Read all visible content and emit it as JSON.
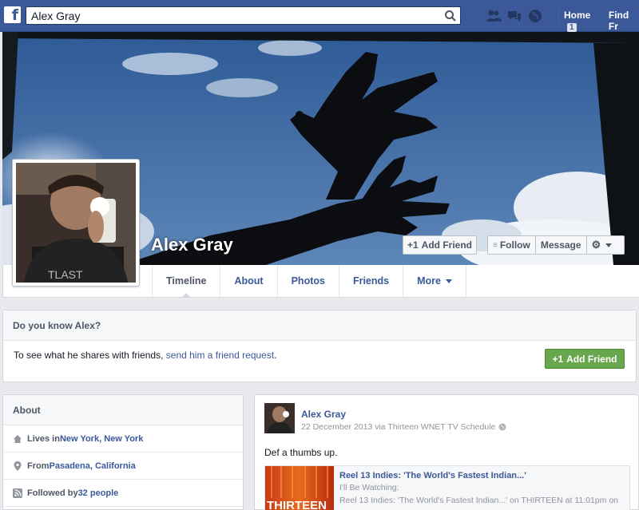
{
  "topbar": {
    "logo": "f",
    "search_value": "Alex Gray",
    "search_icon": "search-icon",
    "jewels": [
      "friend-requests-icon",
      "messages-icon",
      "notifications-globe-icon"
    ],
    "home_label": "Home",
    "home_count": "1",
    "find_friends_label": "Find Fr"
  },
  "profile": {
    "name": "Alex Gray",
    "add_friend_label": "Add Friend",
    "follow_label": "Follow",
    "message_label": "Message"
  },
  "tabs": [
    {
      "label": "Timeline"
    },
    {
      "label": "About"
    },
    {
      "label": "Photos"
    },
    {
      "label": "Friends"
    },
    {
      "label": "More"
    }
  ],
  "know_box": {
    "title": "Do you know Alex?",
    "text_before": "To see what he shares with friends, ",
    "link": "send him a friend request",
    "text_after": ".",
    "button_label": "Add Friend"
  },
  "about": {
    "title": "About",
    "rows": [
      {
        "prefix": "Lives in ",
        "link": "New York, New York",
        "suffix": "",
        "icon": "home-icon"
      },
      {
        "prefix": "From ",
        "link": "Pasadena, California",
        "suffix": "",
        "icon": "location-pin-icon"
      },
      {
        "prefix": "Followed by ",
        "link": "32 people",
        "suffix": "",
        "icon": "followers-icon"
      }
    ]
  },
  "post": {
    "author": "Alex Gray",
    "meta": "22 December 2013 via Thirteen WNET TV Schedule",
    "text": "Def a thumbs up.",
    "share": {
      "title": "Reel 13 Indies: 'The World's Fastest Indian...'",
      "subtitle": "I'll Be Watching:",
      "description": "Reel 13 Indies: 'The World's Fastest Indian...' on THIRTEEN at 11:01pm on",
      "thumb_text": "THIRTEEN"
    }
  },
  "colors": {
    "brand": "#3b5998",
    "green": "#69a74e",
    "sky": "#3f6aa3"
  }
}
